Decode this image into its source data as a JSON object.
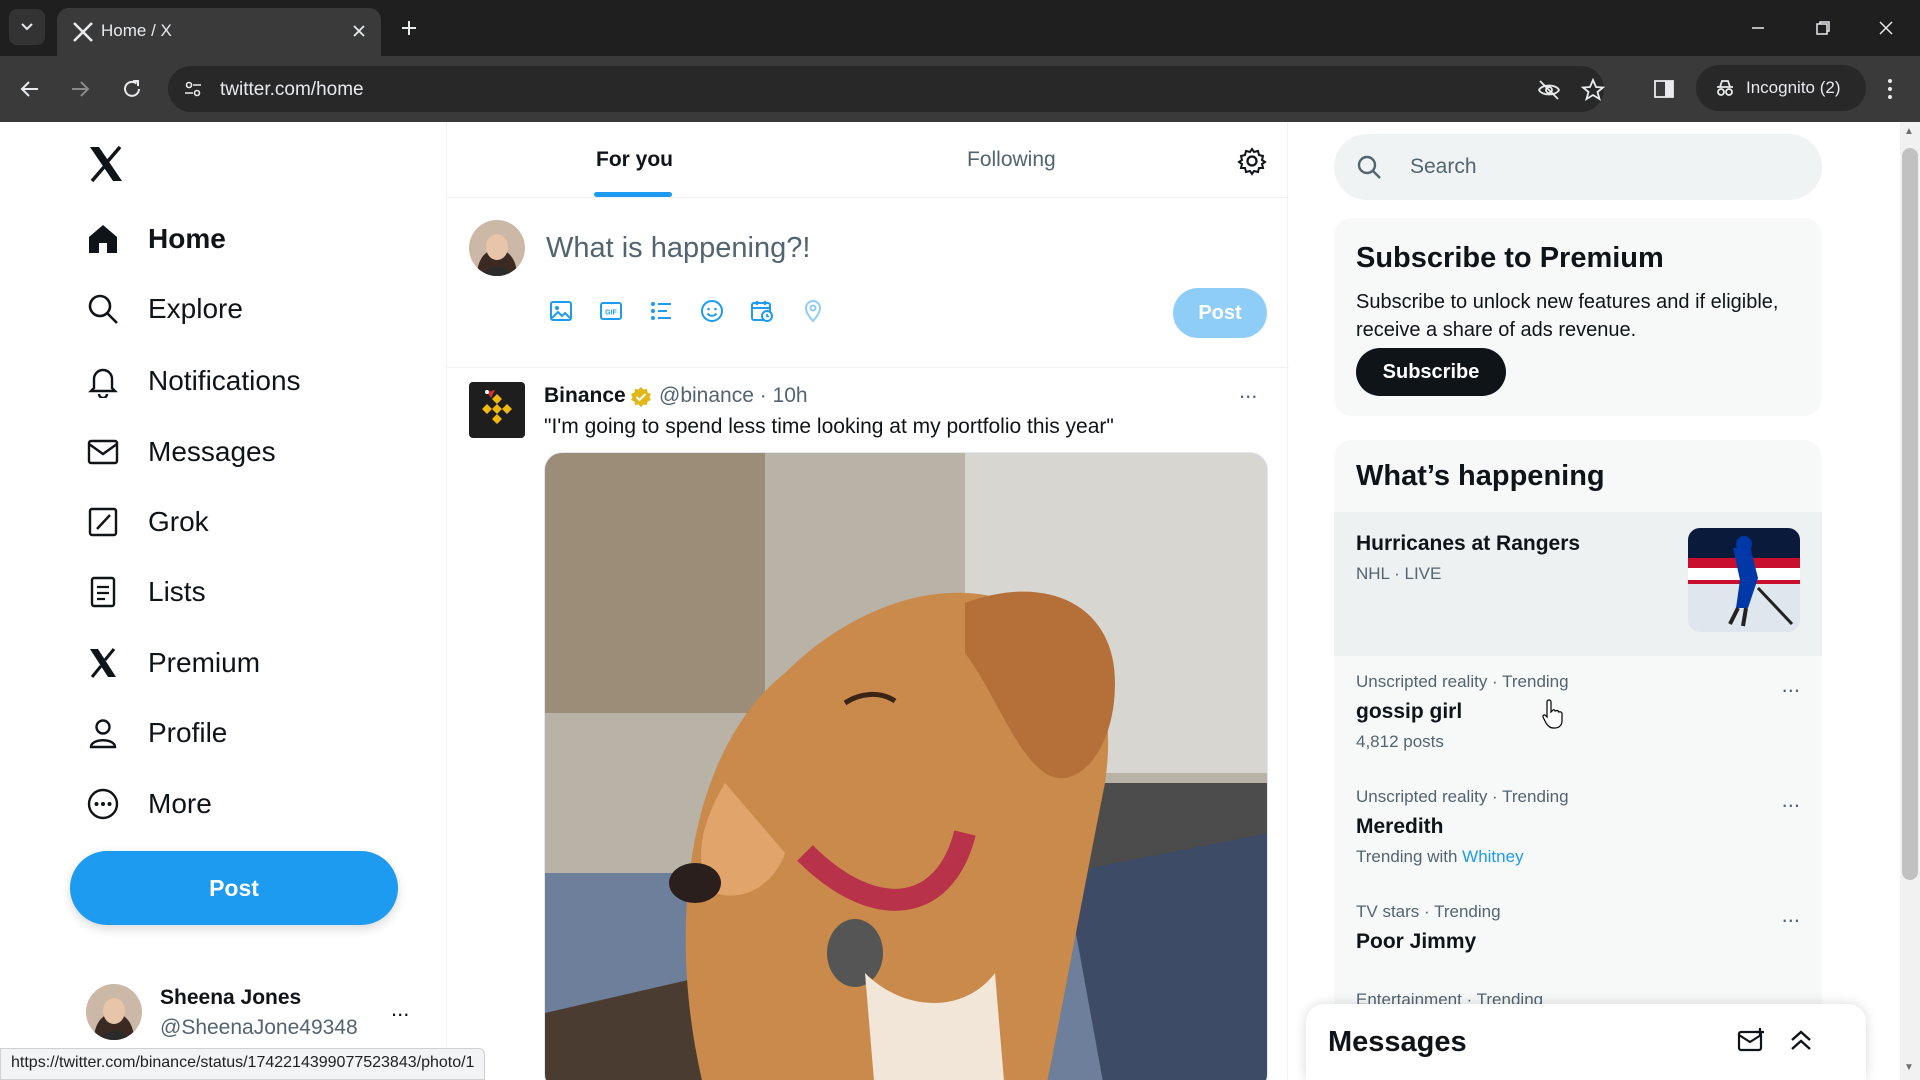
{
  "browser": {
    "tab_title": "Home / X",
    "url": "twitter.com/home",
    "incognito_label": "Incognito (2)",
    "status_url": "https://twitter.com/binance/status/1742214399077523843/photo/1"
  },
  "nav": {
    "items": [
      {
        "label": "Home",
        "icon": "home-icon"
      },
      {
        "label": "Explore",
        "icon": "search-icon"
      },
      {
        "label": "Notifications",
        "icon": "bell-icon"
      },
      {
        "label": "Messages",
        "icon": "mail-icon"
      },
      {
        "label": "Grok",
        "icon": "grok-icon"
      },
      {
        "label": "Lists",
        "icon": "list-icon"
      },
      {
        "label": "Premium",
        "icon": "x-icon"
      },
      {
        "label": "Profile",
        "icon": "person-icon"
      },
      {
        "label": "More",
        "icon": "more-circle-icon"
      }
    ],
    "post_label": "Post",
    "account": {
      "name": "Sheena Jones",
      "handle": "@SheenaJone49348",
      "more": "..."
    }
  },
  "feed": {
    "tabs": [
      "For you",
      "Following"
    ],
    "composer": {
      "placeholder": "What is happening?!",
      "post_label": "Post"
    },
    "tweet": {
      "name": "Binance",
      "handle": "@binance · 10h",
      "text": "\"I'm going to spend less time looking at my portfolio this year\"",
      "more": "..."
    }
  },
  "sidebar": {
    "search_placeholder": "Search",
    "premium": {
      "title": "Subscribe to Premium",
      "body": "Subscribe to unlock new features and if eligible, receive a share of ads revenue.",
      "button": "Subscribe"
    },
    "happening": {
      "title": "What’s happening",
      "highlight": {
        "title": "Hurricanes at Rangers",
        "meta": "NHL · LIVE"
      },
      "trends": [
        {
          "context": "Unscripted reality · Trending",
          "title": "gossip girl",
          "count": "4,812 posts"
        },
        {
          "context": "Unscripted reality · Trending",
          "title": "Meredith",
          "with_prefix": "Trending with",
          "with_link": "Whitney"
        },
        {
          "context": "TV stars · Trending",
          "title": "Poor Jimmy"
        },
        {
          "context": "Entertainment · Trending"
        }
      ],
      "more": "..."
    },
    "messages_title": "Messages"
  },
  "colors": {
    "accent": "#1d9bf0",
    "text": "#0f1419",
    "muted": "#536471"
  }
}
